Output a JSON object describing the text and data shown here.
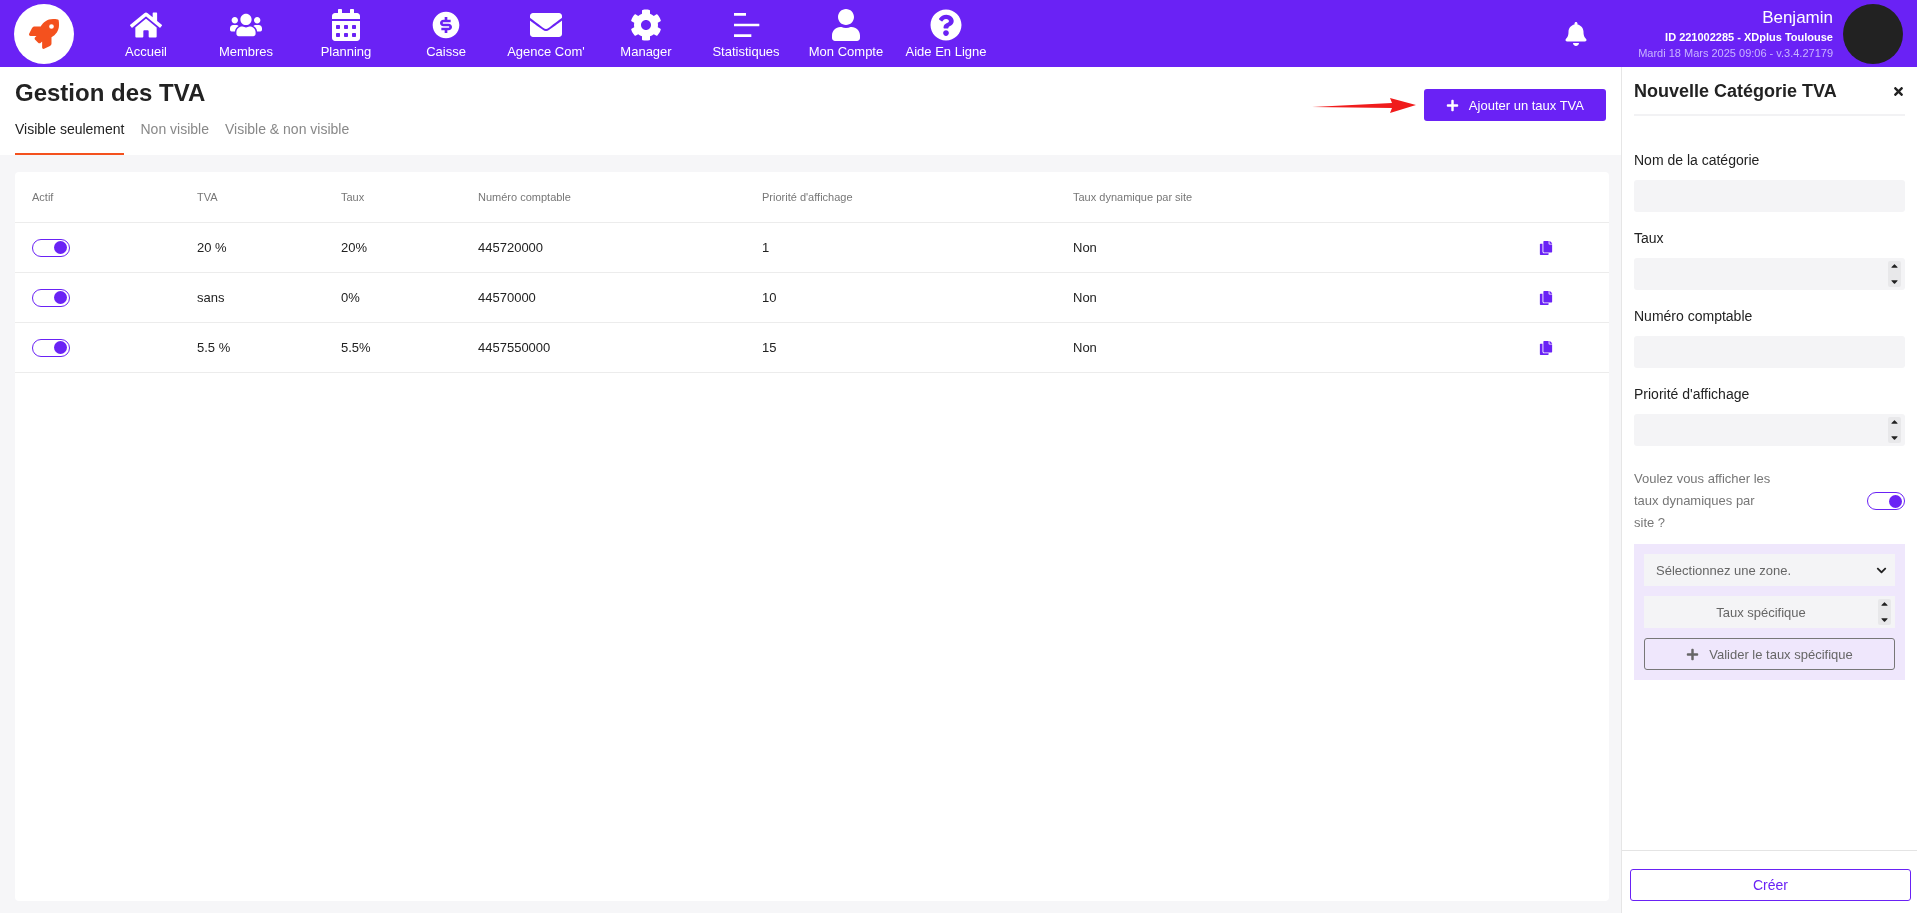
{
  "nav": [
    {
      "label": "Accueil",
      "kind": "home"
    },
    {
      "label": "Membres",
      "kind": "users"
    },
    {
      "label": "Planning",
      "kind": "calendar"
    },
    {
      "label": "Caisse",
      "kind": "cash"
    },
    {
      "label": "Agence Com'",
      "kind": "mail"
    },
    {
      "label": "Manager",
      "kind": "gear"
    },
    {
      "label": "Statistiques",
      "kind": "chart"
    },
    {
      "label": "Mon Compte",
      "kind": "user"
    },
    {
      "label": "Aide En Ligne",
      "kind": "help"
    }
  ],
  "user": {
    "name": "Benjamin",
    "id_line": "ID 221002285 - XDplus Toulouse",
    "date_line": "Mardi 18 Mars 2025 09:06 - v.3.4.27179"
  },
  "page": {
    "title": "Gestion des TVA",
    "add_button": "Ajouter un taux TVA",
    "tabs": [
      {
        "label": "Visible seulement",
        "selected": true
      },
      {
        "label": "Non visible",
        "selected": false
      },
      {
        "label": "Visible & non visible",
        "selected": false
      }
    ]
  },
  "table": {
    "columns": [
      "Actif",
      "TVA",
      "Taux",
      "Numéro comptable",
      "Priorité d'affichage",
      "Taux dynamique par site"
    ],
    "rows": [
      {
        "active": true,
        "tva": "20 %",
        "taux": "20%",
        "numero": "445720000",
        "priorite": "1",
        "dynamique": "Non"
      },
      {
        "active": true,
        "tva": "sans",
        "taux": "0%",
        "numero": "44570000",
        "priorite": "10",
        "dynamique": "Non"
      },
      {
        "active": true,
        "tva": "5.5 %",
        "taux": "5.5%",
        "numero": "4457550000",
        "priorite": "15",
        "dynamique": "Non"
      }
    ]
  },
  "panel": {
    "title": "Nouvelle Catégorie TVA",
    "fields": [
      {
        "label": "Nom de la catégorie",
        "kind": "text"
      },
      {
        "label": "Taux",
        "kind": "number"
      },
      {
        "label": "Numéro comptable",
        "kind": "text"
      },
      {
        "label": "Priorité d'affichage",
        "kind": "number"
      }
    ],
    "dynamic_toggle": {
      "label": "Voulez vous afficher les taux dynamiques par site ?",
      "on": true
    },
    "zone_select": {
      "placeholder": "Sélectionnez une zone."
    },
    "specific_rate": {
      "placeholder": "Taux spécifique"
    },
    "validate_button": "Valider le taux spécifique",
    "create_button": "Créer"
  }
}
